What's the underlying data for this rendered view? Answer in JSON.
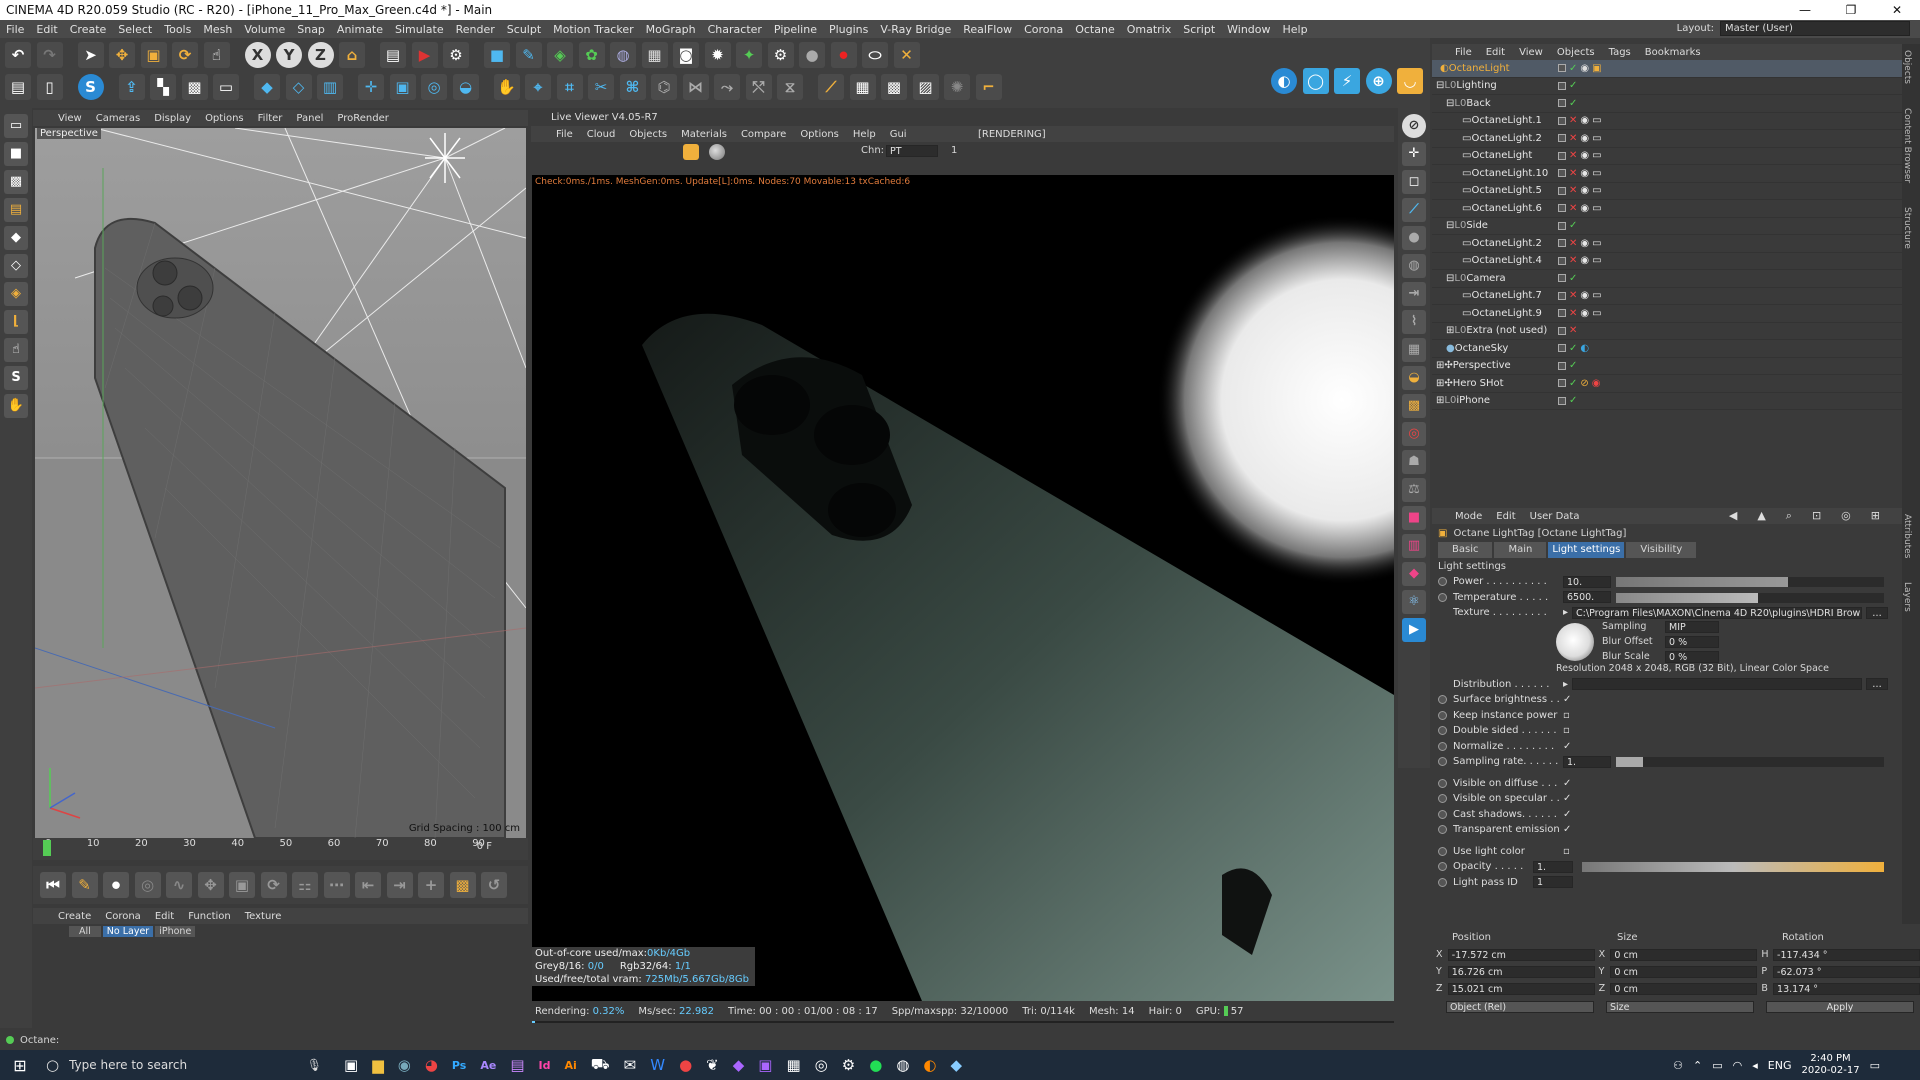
{
  "window": {
    "title": "CINEMA 4D R20.059 Studio (RC - R20) - [iPhone_11_Pro_Max_Green.c4d *] - Main",
    "controls": [
      "—",
      "❐",
      "✕"
    ]
  },
  "menubar": {
    "items": [
      "File",
      "Edit",
      "Create",
      "Select",
      "Tools",
      "Mesh",
      "Volume",
      "Snap",
      "Animate",
      "Simulate",
      "Render",
      "Sculpt",
      "Motion Tracker",
      "MoGraph",
      "Character",
      "Pipeline",
      "Plugins",
      "V-Ray Bridge",
      "RealFlow",
      "Corona",
      "Octane",
      "Omatrix",
      "Script",
      "Window",
      "Help"
    ],
    "layout_label": "Layout:",
    "layout_value": "Master (User)"
  },
  "viewport": {
    "menu": [
      "View",
      "Cameras",
      "Display",
      "Options",
      "Filter",
      "Panel",
      "ProRender"
    ],
    "label": "Perspective",
    "grid_spacing": "Grid Spacing : 100 cm"
  },
  "timeline": {
    "ticks": [
      "0",
      "10",
      "20",
      "30",
      "40",
      "50",
      "60",
      "70",
      "80",
      "90"
    ],
    "frame": "0 F"
  },
  "material_manager": {
    "menu": [
      "Create",
      "Corona",
      "Edit",
      "Function",
      "Texture"
    ],
    "filters": [
      "All",
      "No Layer",
      "iPhone"
    ]
  },
  "live_viewer": {
    "title": "Live Viewer V4.05-R7",
    "menu": [
      "File",
      "Cloud",
      "Objects",
      "Materials",
      "Compare",
      "Options",
      "Help",
      "Gui"
    ],
    "status_tag": "[RENDERING]",
    "chn_label": "Chn:",
    "chn_value": "PT",
    "chn_num": "1",
    "status_line": "Check:0ms./1ms. MeshGen:0ms. Update[L]:0ms. Nodes:70 Movable:13 txCached:6",
    "stats": [
      {
        "label": "Out-of-core used/max:",
        "value": "0Kb/4Gb"
      },
      {
        "label": "Grey8/16: ",
        "value": "0/0",
        "label2": "Rgb32/64: ",
        "value2": "1/1"
      },
      {
        "label": "Used/free/total vram: ",
        "value": "725Mb/5.667Gb/8Gb"
      }
    ],
    "bottom": [
      {
        "label": "Rendering:",
        "value": "0.32%"
      },
      {
        "label": "Ms/sec:",
        "value": "22.982"
      },
      {
        "label": "Time:",
        "value": "00 : 00 : 01/00 : 08 : 17"
      },
      {
        "label": "Spp/maxspp:",
        "value": "32/10000"
      },
      {
        "label": "Tri:",
        "value": "0/114k"
      },
      {
        "label": "Mesh:",
        "value": "14"
      },
      {
        "label": "Hair:",
        "value": "0"
      },
      {
        "label": "GPU:",
        "value": "57"
      }
    ]
  },
  "object_manager": {
    "menu": [
      "File",
      "Edit",
      "View",
      "Objects",
      "Tags",
      "Bookmarks"
    ],
    "rows": [
      {
        "name": "OctaneLight",
        "indent": 0,
        "selected": true
      },
      {
        "name": "Lighting",
        "indent": 0
      },
      {
        "name": "Back",
        "indent": 1
      },
      {
        "name": "OctaneLight.1",
        "indent": 2
      },
      {
        "name": "OctaneLight.2",
        "indent": 2
      },
      {
        "name": "OctaneLight",
        "indent": 2
      },
      {
        "name": "OctaneLight.10",
        "indent": 2
      },
      {
        "name": "OctaneLight.5",
        "indent": 2
      },
      {
        "name": "OctaneLight.6",
        "indent": 2
      },
      {
        "name": "Side",
        "indent": 1
      },
      {
        "name": "OctaneLight.2",
        "indent": 2
      },
      {
        "name": "OctaneLight.4",
        "indent": 2
      },
      {
        "name": "Camera",
        "indent": 1
      },
      {
        "name": "OctaneLight.7",
        "indent": 2
      },
      {
        "name": "OctaneLight.9",
        "indent": 2
      },
      {
        "name": "Extra (not used)",
        "indent": 1
      },
      {
        "name": "OctaneSky",
        "indent": 0
      },
      {
        "name": "Perspective",
        "indent": 0
      },
      {
        "name": "Hero SHot",
        "indent": 0
      },
      {
        "name": "iPhone",
        "indent": 0
      }
    ],
    "side_tabs": [
      "Objects",
      "Content Browser",
      "Structure"
    ]
  },
  "attributes": {
    "menu": [
      "Mode",
      "Edit",
      "User Data"
    ],
    "title": "Octane LightTag [Octane LightTag]",
    "tabs": [
      "Basic",
      "Main",
      "Light settings",
      "Visibility"
    ],
    "active_tab": "Light settings",
    "section": "Light settings",
    "power": {
      "label": "Power . . . . . . . . . .",
      "value": "10.",
      "fraction": 0.64
    },
    "temperature": {
      "label": "Temperature . . . . .",
      "value": "6500.",
      "fraction": 0.53
    },
    "texture": {
      "label": "Texture . . . . . . . . .",
      "value": "C:\\Program Files\\MAXON\\Cinema 4D R20\\plugins\\HDRI Brow"
    },
    "sampling": {
      "label": "Sampling",
      "value": "MIP"
    },
    "blur_offset": {
      "label": "Blur Offset",
      "value": "0 %"
    },
    "blur_scale": {
      "label": "Blur Scale",
      "value": "0 %"
    },
    "resolution": "Resolution 2048 x 2048, RGB (32 Bit), Linear Color Space",
    "distribution": {
      "label": "Distribution . . . . . ."
    },
    "checks": [
      {
        "label": "Surface brightness . .",
        "checked": true
      },
      {
        "label": "Keep instance power",
        "checked": false
      },
      {
        "label": "Double sided . . . . . .",
        "checked": false
      },
      {
        "label": "Normalize . . . . . . . .",
        "checked": true
      }
    ],
    "sampling_rate": {
      "label": "Sampling rate. . . . . .",
      "value": "1.",
      "fraction": 0.1
    },
    "vis_checks": [
      {
        "label": "Visible on diffuse . . .",
        "checked": true
      },
      {
        "label": "Visible on specular . .",
        "checked": true
      },
      {
        "label": "Cast shadows. . . . . .",
        "checked": true
      },
      {
        "label": "Transparent emission",
        "checked": true
      }
    ],
    "use_light_color": {
      "label": "Use light color",
      "checked": false
    },
    "opacity": {
      "label": "Opacity . . . . .",
      "value": "1.",
      "fraction": 1.0
    },
    "light_pass": {
      "label": "Light pass ID",
      "value": "1"
    },
    "side_tabs": [
      "Attributes",
      "Layers"
    ]
  },
  "coordinates": {
    "headers": [
      "Position",
      "Size",
      "Rotation"
    ],
    "rows": [
      {
        "axis": "X",
        "pos": "-17.572 cm",
        "size_axis": "X",
        "size": "0 cm",
        "rot_axis": "H",
        "rot": "-117.434 °"
      },
      {
        "axis": "Y",
        "pos": "16.726 cm",
        "size_axis": "Y",
        "size": "0 cm",
        "rot_axis": "P",
        "rot": "-62.073 °"
      },
      {
        "axis": "Z",
        "pos": "15.021 cm",
        "size_axis": "Z",
        "size": "0 cm",
        "rot_axis": "B",
        "rot": "13.174 °"
      }
    ],
    "mode": "Object (Rel)",
    "size_mode": "Size",
    "apply": "Apply"
  },
  "status_bar": {
    "text": "Octane:"
  },
  "taskbar": {
    "search": "Type here to search",
    "lang": "ENG",
    "time": "2:40 PM",
    "date": "2020-02-17"
  },
  "colors": {
    "accent": "#f0b03c",
    "select": "#3b6fa8",
    "render_bg": "#000000"
  }
}
